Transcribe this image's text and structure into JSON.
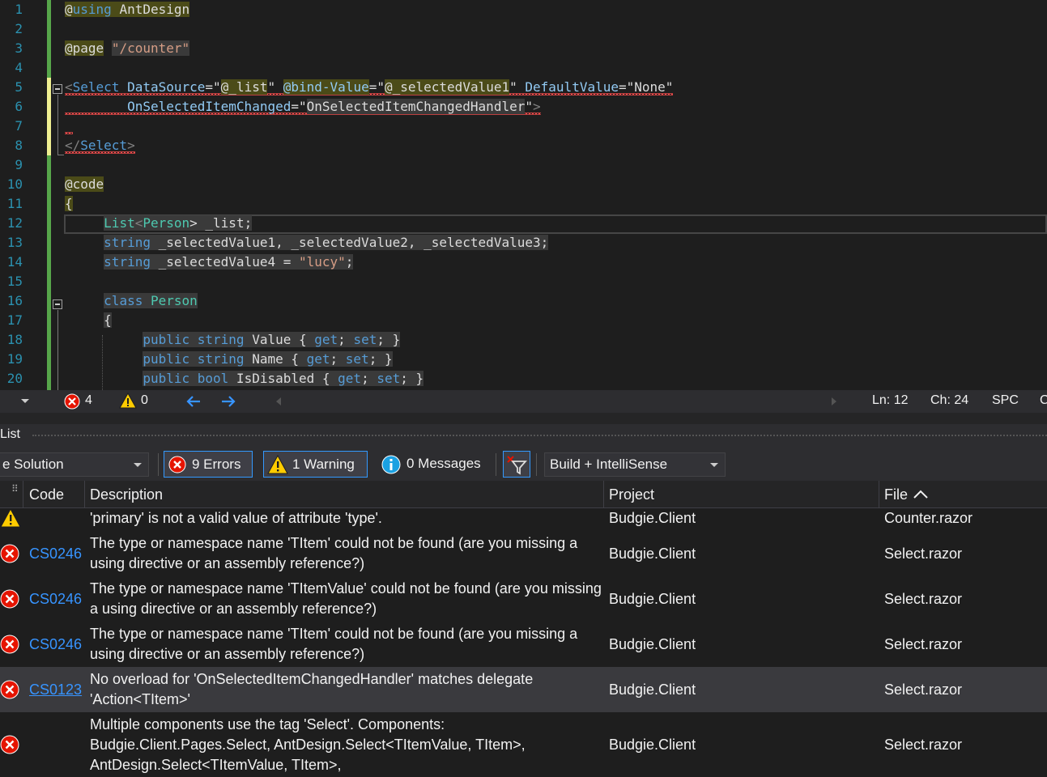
{
  "editor": {
    "line_numbers": [
      "1",
      "2",
      "3",
      "4",
      "5",
      "6",
      "7",
      "8",
      "9",
      "10",
      "11",
      "12",
      "13",
      "14",
      "15",
      "16",
      "17",
      "18",
      "19",
      "20"
    ],
    "lines": {
      "l1_at": "@",
      "l1_using": "using",
      "l1_ns": " AntDesign",
      "l3_page": "@page",
      "l3_route": "\"/counter\"",
      "l5_lt": "<",
      "l5_tag": "Select",
      "l5_a1": "DataSource",
      "l5_eq1": "=\"",
      "l5_v1": "@_list",
      "l5_q1": "\"",
      "l5_a2": "@bind-Value",
      "l5_eq2": "=\"",
      "l5_v2": "@_selectedValue1",
      "l5_q2": "\"",
      "l5_a3": "DefaultValue",
      "l5_eq3": "=\"",
      "l5_v3": "None",
      "l5_q3": "\"",
      "l6_a": "OnSelectedItemChanged",
      "l6_eq": "=\"",
      "l6_v": "OnSelectedItemChangedHandler",
      "l6_q": "\"",
      "l6_gt": ">",
      "l8_close": "</",
      "l8_tag": "Select",
      "l8_gt": ">",
      "l10": "@code",
      "l11": "{",
      "l12_t1": "List",
      "l12_lt": "<",
      "l12_t2": "Person",
      "l12_rest": "> _list;",
      "l13_kw": "string",
      "l13_rest": " _selectedValue1, _selectedValue2, _selectedValue3;",
      "l14_kw": "string",
      "l14_mid": " _selectedValue4 = ",
      "l14_str": "\"lucy\"",
      "l14_end": ";",
      "l16_kw": "class",
      "l16_t": "Person",
      "l17": "{",
      "l18_k1": "public",
      "l18_k2": "string",
      "l18_n": " Value { ",
      "l18_g": "get",
      "l18_s1": "; ",
      "l18_s": "set",
      "l18_e": "; }",
      "l19_k1": "public",
      "l19_k2": "string",
      "l19_n": " Name { ",
      "l19_g": "get",
      "l19_s1": "; ",
      "l19_s": "set",
      "l19_e": "; }",
      "l20_k1": "public",
      "l20_k2": "bool",
      "l20_n": " IsDisabled { ",
      "l20_g": "get",
      "l20_s1": "; ",
      "l20_s": "set",
      "l20_e": "; }"
    }
  },
  "statusbar": {
    "errors": "4",
    "warnings": "0",
    "ln": "Ln: 12",
    "ch": "Ch: 24",
    "spc": "SPC",
    "cut": "C"
  },
  "panel": {
    "title": "List",
    "scope": "e Solution",
    "errors_btn": "9 Errors",
    "warning_btn": "1 Warning",
    "messages_btn": "0 Messages",
    "source": "Build + IntelliSense"
  },
  "columns": {
    "code": "Code",
    "description": "Description",
    "project": "Project",
    "file": "File"
  },
  "errors": [
    {
      "severity": "warning",
      "code": "",
      "description": "'primary' is not a valid value of attribute 'type'.",
      "project": "Budgie.Client",
      "file": "Counter.razor"
    },
    {
      "severity": "error",
      "code": "CS0246",
      "description": "The type or namespace name 'TItem' could not be found (are you missing a using directive or an assembly reference?)",
      "project": "Budgie.Client",
      "file": "Select.razor"
    },
    {
      "severity": "error",
      "code": "CS0246",
      "description": "The type or namespace name 'TItemValue' could not be found (are you missing a using directive or an assembly reference?)",
      "project": "Budgie.Client",
      "file": "Select.razor"
    },
    {
      "severity": "error",
      "code": "CS0246",
      "description": "The type or namespace name 'TItem' could not be found (are you missing a using directive or an assembly reference?)",
      "project": "Budgie.Client",
      "file": "Select.razor"
    },
    {
      "severity": "error",
      "code": "CS0123",
      "description": "No overload for 'OnSelectedItemChangedHandler' matches delegate 'Action<TItem>'",
      "project": "Budgie.Client",
      "file": "Select.razor"
    },
    {
      "severity": "error",
      "code": "",
      "description": "Multiple components use the tag 'Select'. Components: Budgie.Client.Pages.Select, AntDesign.Select<TItemValue, TItem>, AntDesign.Select<TItemValue, TItem>, Microsoft.AspNetCore.Components.Bind",
      "project": "Budgie.Client",
      "file": "Select.razor"
    }
  ],
  "colors": {
    "error_red": "#e51400",
    "warning_yellow": "#ffcc00",
    "info_blue": "#1ba1e2",
    "link_blue": "#3794ff",
    "selection_blue": "#3399ff"
  }
}
